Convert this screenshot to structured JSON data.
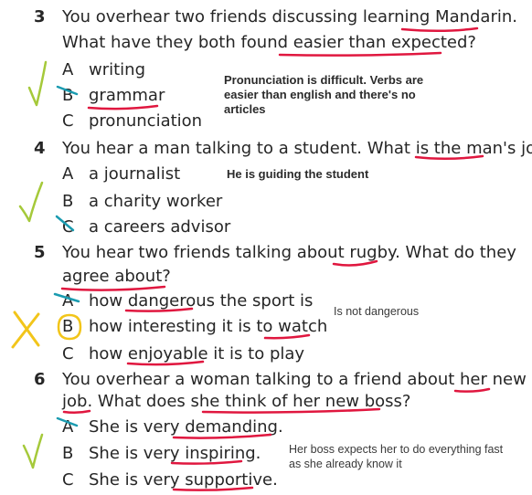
{
  "questions": [
    {
      "number": "3",
      "line1": "You overhear two friends discussing learning Mandarin.",
      "line2": "What have they both found easier than expected?",
      "options": [
        {
          "letter": "A",
          "text": "writing"
        },
        {
          "letter": "B",
          "text": "grammar"
        },
        {
          "letter": "C",
          "text": "pronunciation"
        }
      ],
      "note": "Pronunciation is difficult. Verbs are easier than english and there's no articles",
      "mark": "tick"
    },
    {
      "number": "4",
      "line1": "You hear a man talking to a student. What is the man's job?",
      "options": [
        {
          "letter": "A",
          "text": "a journalist"
        },
        {
          "letter": "B",
          "text": "a charity worker"
        },
        {
          "letter": "C",
          "text": "a careers advisor"
        }
      ],
      "note": "He is guiding the student",
      "mark": "tick"
    },
    {
      "number": "5",
      "line1": "You hear two friends talking about rugby. What do they",
      "line2": "agree about?",
      "options": [
        {
          "letter": "A",
          "text": "how dangerous the sport is"
        },
        {
          "letter": "B",
          "text": "how interesting it is to watch"
        },
        {
          "letter": "C",
          "text": "how enjoyable it is to play"
        }
      ],
      "note": "Is not dangerous",
      "mark": "cross"
    },
    {
      "number": "6",
      "line1": "You overhear a woman talking to a friend about her new",
      "line2": "job. What does she think of her new boss?",
      "options": [
        {
          "letter": "A",
          "text": "She is very demanding."
        },
        {
          "letter": "B",
          "text": "She is very inspiring."
        },
        {
          "letter": "C",
          "text": "She is very supportive."
        }
      ],
      "note": "Her boss expects her to do everything fast as she already know it",
      "mark": "tick"
    }
  ],
  "colors": {
    "underline": "#e0173f",
    "strike": "#1a9bb0",
    "tick": "#a5c93a",
    "cross": "#f2c51a",
    "circle": "#f2c51a"
  }
}
